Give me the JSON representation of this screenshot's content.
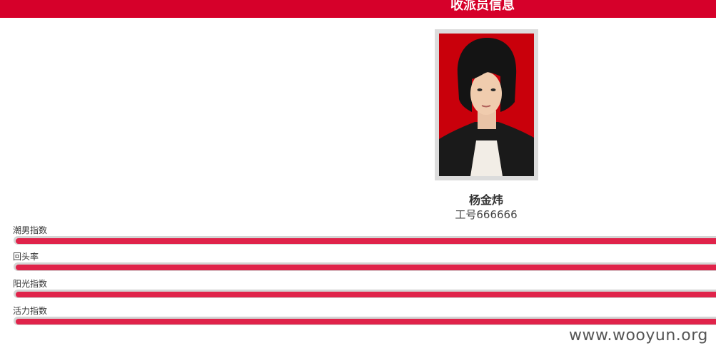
{
  "header": {
    "title": "收派员信息"
  },
  "profile": {
    "name": "杨金炜",
    "staff_id": "工号666666"
  },
  "metrics": [
    {
      "label": "潮男指数",
      "level": 1.0
    },
    {
      "label": "回头率",
      "level": 1.0
    },
    {
      "label": "阳光指数",
      "level": 1.0
    },
    {
      "label": "活力指数",
      "level": 1.0
    }
  ],
  "watermark": "www.wooyun.org",
  "colors": {
    "header_bg": "#d6002a",
    "bar_fill": "#e0234a",
    "bar_track": "#d4d4d4",
    "photo_bg": "#c9000b"
  }
}
